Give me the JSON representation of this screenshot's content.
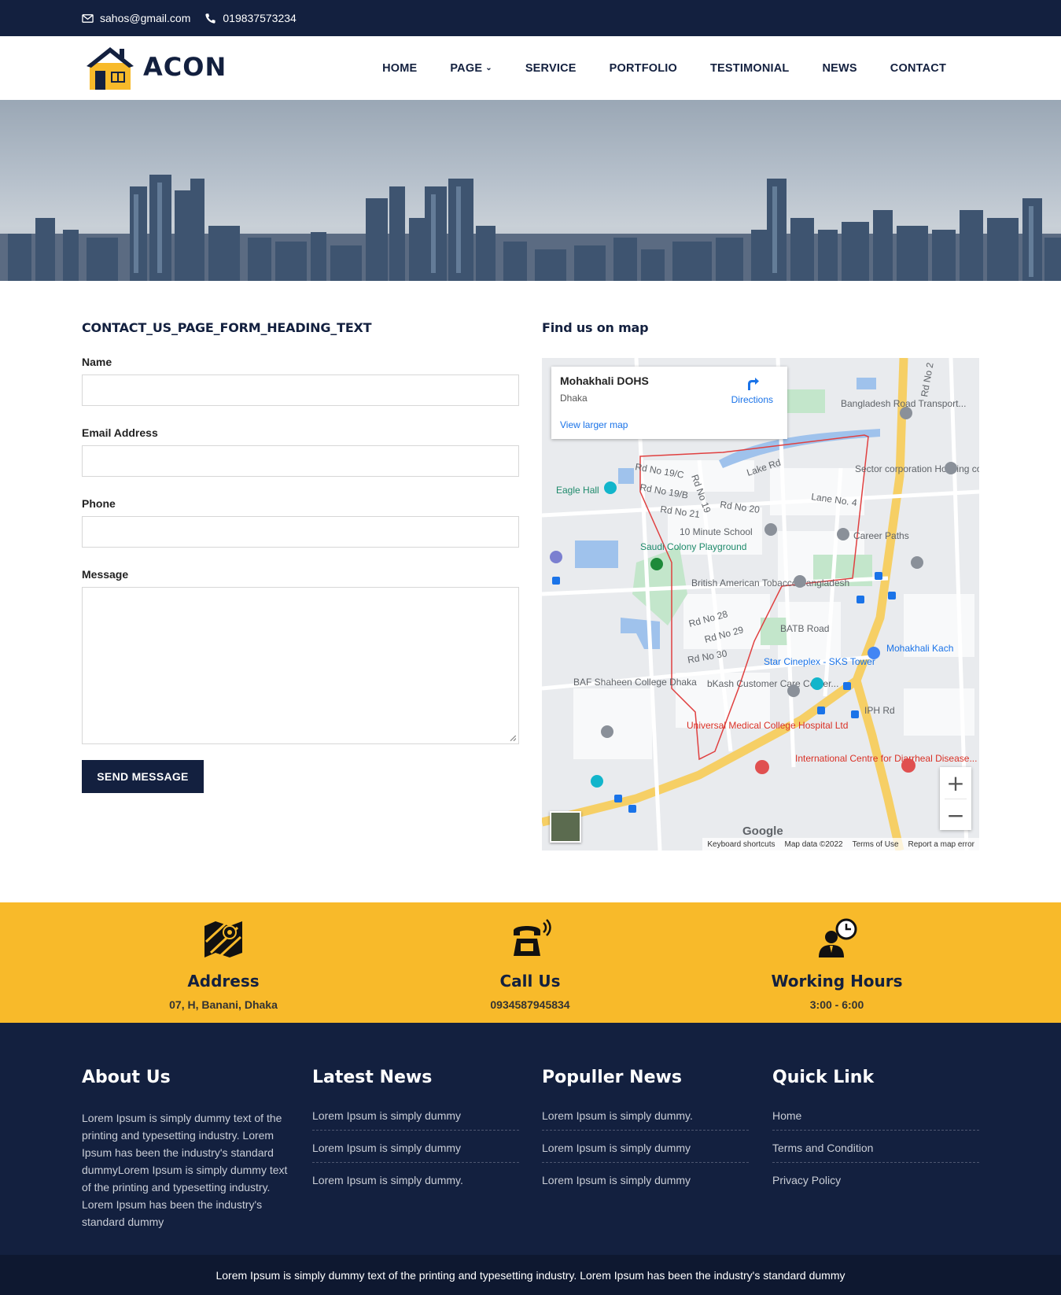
{
  "topbar": {
    "email": "sahos@gmail.com",
    "phone": "019837573234"
  },
  "brand": {
    "name": "ACON",
    "primary_color": "#13203f",
    "accent_color": "#f8ba2a"
  },
  "nav": {
    "items": [
      {
        "label": "HOME"
      },
      {
        "label": "PAGE"
      },
      {
        "label": "SERVICE"
      },
      {
        "label": "PORTFOLIO"
      },
      {
        "label": "TESTIMONIAL"
      },
      {
        "label": "NEWS"
      },
      {
        "label": "CONTACT"
      }
    ]
  },
  "form": {
    "heading": "CONTACT_US_PAGE_FORM_HEADING_TEXT",
    "name_label": "Name",
    "email_label": "Email Address",
    "phone_label": "Phone",
    "message_label": "Message",
    "name_value": "",
    "email_value": "",
    "phone_value": "",
    "message_value": "",
    "submit_label": "SEND MESSAGE"
  },
  "map": {
    "heading": "Find us on map",
    "place": "Mohakhali DOHS",
    "city": "Dhaka",
    "directions_label": "Directions",
    "larger_map_label": "View larger map",
    "brand": "Google",
    "footer": [
      "Keyboard shortcuts",
      "Map data ©2022",
      "Terms of Use",
      "Report a map error"
    ],
    "labels": [
      "Bangladesh Road Transport...",
      "Sector corporation Housing complex",
      "Eagle Hall",
      "Lake Rd",
      "Rd No 20",
      "Lane No. 4",
      "10 Minute School",
      "Career Paths",
      "Saudi Colony Playground",
      "British American Tobacco Bangladesh",
      "BATB Road",
      "Star Cineplex - SKS Tower",
      "Mohakhali Kach",
      "BAF Shaheen College Dhaka",
      "bKash Customer Care Center...",
      "Universal Medical College Hospital Ltd",
      "International Centre for Diarrheal Disease...",
      "IPH Rd",
      "Rd No 2",
      "Rd No 28",
      "Rd No 29",
      "Rd No 30",
      "Rd No 19/C",
      "Rd No 19/B",
      "Rd No 21",
      "Rd No 19"
    ]
  },
  "info": [
    {
      "icon": "map-icon",
      "title": "Address",
      "value": "07, H, Banani, Dhaka"
    },
    {
      "icon": "telephone-icon",
      "title": "Call Us",
      "value": "0934587945834"
    },
    {
      "icon": "clock-person-icon",
      "title": "Working Hours",
      "value": "3:00 - 6:00"
    }
  ],
  "footer": {
    "about": {
      "title": "About Us",
      "text": "Lorem Ipsum is simply dummy text of the printing and typesetting industry. Lorem Ipsum has been the industry's standard dummyLorem Ipsum is simply dummy text of the printing and typesetting industry. Lorem Ipsum has been the industry's standard dummy"
    },
    "latest": {
      "title": "Latest News",
      "items": [
        "Lorem Ipsum is simply dummy",
        "Lorem Ipsum is simply dummy",
        "Lorem Ipsum is simply dummy."
      ]
    },
    "popular": {
      "title": "Populler News",
      "items": [
        "Lorem Ipsum is simply dummy.",
        "Lorem Ipsum is simply dummy",
        "Lorem Ipsum is simply dummy"
      ]
    },
    "quick": {
      "title": "Quick Link",
      "items": [
        "Home",
        "Terms and Condition",
        "Privacy Policy"
      ]
    }
  },
  "copyright": "Lorem Ipsum is simply dummy text of the printing and typesetting industry. Lorem Ipsum has been the industry's standard dummy"
}
